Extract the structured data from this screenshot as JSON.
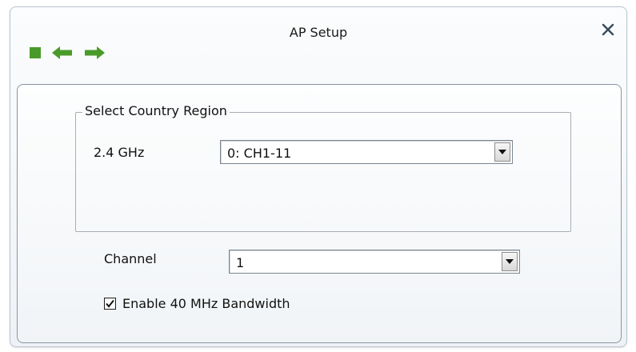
{
  "window": {
    "title": "AP Setup",
    "close_glyph": "✕"
  },
  "toolbar": {
    "items": [
      {
        "name": "stop",
        "icon": "green-square-icon"
      },
      {
        "name": "back",
        "icon": "left-arrow-icon"
      },
      {
        "name": "forward",
        "icon": "right-arrow-icon"
      }
    ],
    "icon_color": "#4a9a2a"
  },
  "country_region": {
    "legend": "Select Country Region",
    "band_label": "2.4 GHz",
    "band_value": "0: CH1-11"
  },
  "channel": {
    "label": "Channel",
    "value": "1"
  },
  "bandwidth": {
    "label": "Enable 40 MHz Bandwidth",
    "checked": true
  }
}
